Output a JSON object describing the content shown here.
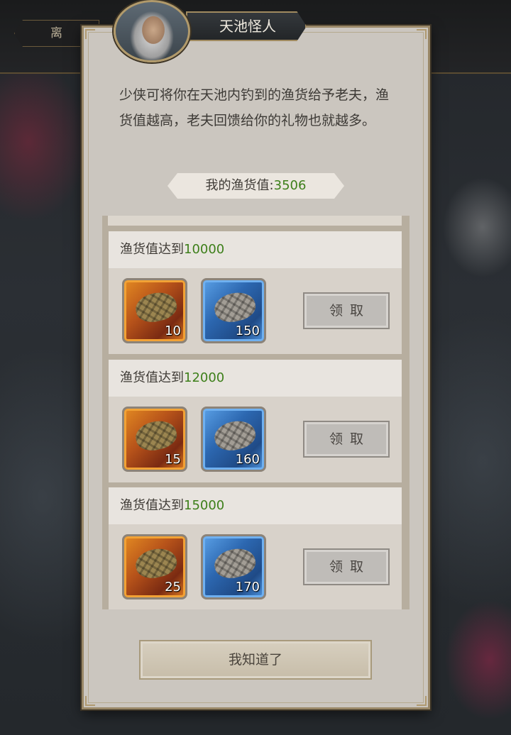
{
  "topbar": {
    "leave_label": "离 开"
  },
  "dialog": {
    "npc_name": "天池怪人",
    "intro": "少侠可将你在天池内钓到的渔货给予老夫，渔货值越高，老夫回馈给你的礼物也就越多。",
    "my_value_label": "我的渔货值:",
    "my_value": "3506",
    "ok_label": "我知道了"
  },
  "rewards": [
    {
      "label": "渔货值达到",
      "threshold": "10000",
      "items": [
        {
          "icon": "turtle-shell-gold-icon",
          "rarity": "orange",
          "count": "10"
        },
        {
          "icon": "turtle-shell-silver-icon",
          "rarity": "blue",
          "count": "150"
        }
      ],
      "claim_label": "领取"
    },
    {
      "label": "渔货值达到",
      "threshold": "12000",
      "items": [
        {
          "icon": "turtle-shell-gold-icon",
          "rarity": "orange",
          "count": "15"
        },
        {
          "icon": "turtle-shell-silver-icon",
          "rarity": "blue",
          "count": "160"
        }
      ],
      "claim_label": "领取"
    },
    {
      "label": "渔货值达到",
      "threshold": "15000",
      "items": [
        {
          "icon": "turtle-shell-gold-icon",
          "rarity": "orange",
          "count": "25"
        },
        {
          "icon": "turtle-shell-silver-icon",
          "rarity": "blue",
          "count": "170"
        }
      ],
      "claim_label": "领取"
    }
  ],
  "colors": {
    "highlight_number": "#3d7f1a",
    "panel": "#cbc6bf",
    "frame": "#9a8867"
  }
}
